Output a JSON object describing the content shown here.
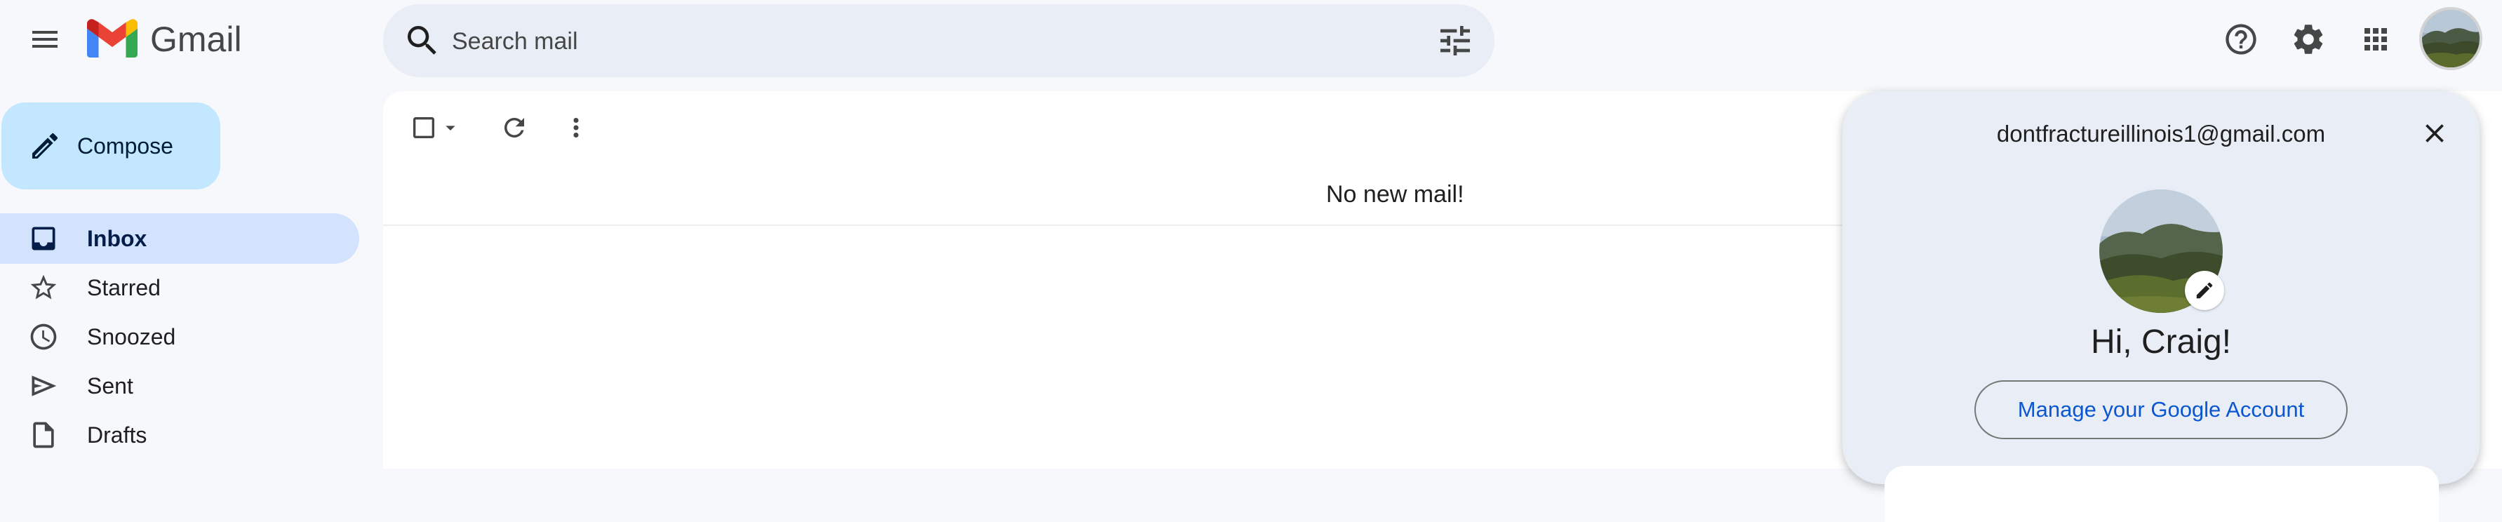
{
  "app": {
    "name": "Gmail",
    "icons": {
      "menu": "menu-icon",
      "logo": "gmail-logo",
      "search": "search-icon",
      "tune": "tune-icon",
      "help": "help-icon",
      "settings": "gear-icon",
      "apps": "apps-grid-icon"
    }
  },
  "search": {
    "placeholder": "Search mail",
    "value": ""
  },
  "sidebar": {
    "compose_label": "Compose",
    "items": [
      {
        "label": "Inbox",
        "icon": "inbox-icon",
        "active": true
      },
      {
        "label": "Starred",
        "icon": "star-icon",
        "active": false
      },
      {
        "label": "Snoozed",
        "icon": "clock-icon",
        "active": false
      },
      {
        "label": "Sent",
        "icon": "send-icon",
        "active": false
      },
      {
        "label": "Drafts",
        "icon": "draft-icon",
        "active": false
      }
    ]
  },
  "toolbar": {
    "icons": [
      "checkbox-icon",
      "caret-down-icon",
      "refresh-icon",
      "more-vert-icon"
    ]
  },
  "mail_list": {
    "empty_message": "No new mail!"
  },
  "account_popup": {
    "email": "dontfractureillinois1@gmail.com",
    "greeting": "Hi, Craig!",
    "manage_label": "Manage your Google Account"
  },
  "colors": {
    "background": "#f6f8fc",
    "search_bg": "#e9eef6",
    "compose_bg": "#c2e7ff",
    "active_nav_bg": "#d3e3fd",
    "link_blue": "#0b57d0",
    "gmail_red": "#ea4335",
    "gmail_blue": "#4285f4",
    "gmail_green": "#34a853",
    "gmail_yellow": "#fbbc04"
  }
}
